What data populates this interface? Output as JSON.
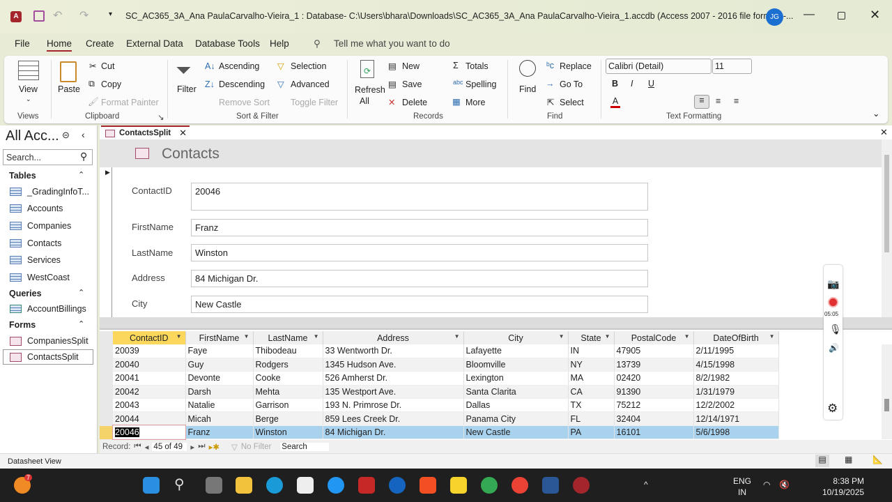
{
  "window": {
    "title": "SC_AC365_3A_Ana PaulaCarvalho-Vieira_1 : Database- C:\\Users\\bhara\\Downloads\\SC_AC365_3A_Ana PaulaCarvalho-Vieira_1.accdb (Access 2007 - 2016 file format)  -...",
    "user_initials": "JG"
  },
  "menu": {
    "tabs": [
      "File",
      "Home",
      "Create",
      "External Data",
      "Database Tools",
      "Help"
    ],
    "active": "Home",
    "tell_me": "Tell me what you want to do"
  },
  "ribbon": {
    "view": "View",
    "views_group": "Views",
    "paste": "Paste",
    "cut": "Cut",
    "copy": "Copy",
    "format_painter": "Format Painter",
    "clipboard_group": "Clipboard",
    "filter": "Filter",
    "ascending": "Ascending",
    "descending": "Descending",
    "remove_sort": "Remove Sort",
    "selection": "Selection",
    "advanced": "Advanced",
    "toggle_filter": "Toggle Filter",
    "sort_group": "Sort & Filter",
    "refresh": "Refresh",
    "refresh_all": "All",
    "new": "New",
    "save": "Save",
    "delete": "Delete",
    "totals": "Totals",
    "spelling": "Spelling",
    "more": "More",
    "records_group": "Records",
    "find": "Find",
    "replace": "Replace",
    "goto": "Go To",
    "select": "Select",
    "find_group": "Find",
    "font": "Calibri (Detail)",
    "font_size": "11",
    "bold": "B",
    "italic": "I",
    "underline": "U",
    "text_group": "Text Formatting"
  },
  "nav": {
    "title": "All Acc...",
    "search_placeholder": "Search...",
    "sections": [
      {
        "label": "Tables",
        "items": [
          "_GradingInfoT...",
          "Accounts",
          "Companies",
          "Contacts",
          "Services",
          "WestCoast"
        ]
      },
      {
        "label": "Queries",
        "items": [
          "AccountBillings"
        ]
      },
      {
        "label": "Forms",
        "items": [
          "CompaniesSplit",
          "ContactsSplit"
        ]
      }
    ]
  },
  "doc_tab": "ContactsSplit",
  "form": {
    "title": "Contacts",
    "fields": [
      {
        "label": "ContactID",
        "value": "20046"
      },
      {
        "label": "FirstName",
        "value": "Franz"
      },
      {
        "label": "LastName",
        "value": "Winston"
      },
      {
        "label": "Address",
        "value": "84 Michigan Dr."
      },
      {
        "label": "City",
        "value": "New Castle"
      }
    ]
  },
  "datasheet": {
    "columns": [
      "ContactID",
      "FirstName",
      "LastName",
      "Address",
      "City",
      "State",
      "PostalCode",
      "DateOfBirth"
    ],
    "rows": [
      [
        "20039",
        "Faye",
        "Thibodeau",
        "33 Wentworth Dr.",
        "Lafayette",
        "IN",
        "47905",
        "2/11/1995"
      ],
      [
        "20040",
        "Guy",
        "Rodgers",
        "1345 Hudson Ave.",
        "Bloomville",
        "NY",
        "13739",
        "4/15/1998"
      ],
      [
        "20041",
        "Devonte",
        "Cooke",
        "526 Amherst Dr.",
        "Lexington",
        "MA",
        "02420",
        "8/2/1982"
      ],
      [
        "20042",
        "Darsh",
        "Mehta",
        "135 Westport Ave.",
        "Santa Clarita",
        "CA",
        "91390",
        "1/31/1979"
      ],
      [
        "20043",
        "Natalie",
        "Garrison",
        "193 N. Primrose Dr.",
        "Dallas",
        "TX",
        "75212",
        "12/2/2002"
      ],
      [
        "20044",
        "Micah",
        "Berge",
        "859 Lees Creek Dr.",
        "Panama City",
        "FL",
        "32404",
        "12/14/1971"
      ],
      [
        "20046",
        "Franz",
        "Winston",
        "84 Michigan Dr.",
        "New Castle",
        "PA",
        "16101",
        "5/6/1998"
      ]
    ],
    "selected_index": 6,
    "record_label": "Record:",
    "record_position": "45 of 49",
    "no_filter": "No Filter",
    "search": "Search"
  },
  "status": {
    "text": "Datasheet View"
  },
  "taskbar": {
    "weather_badge": "7",
    "lang": "ENG",
    "region": "IN",
    "time": "8:38 PM",
    "date": "10/19/2025"
  },
  "recorder": {
    "timer": "05:05"
  }
}
